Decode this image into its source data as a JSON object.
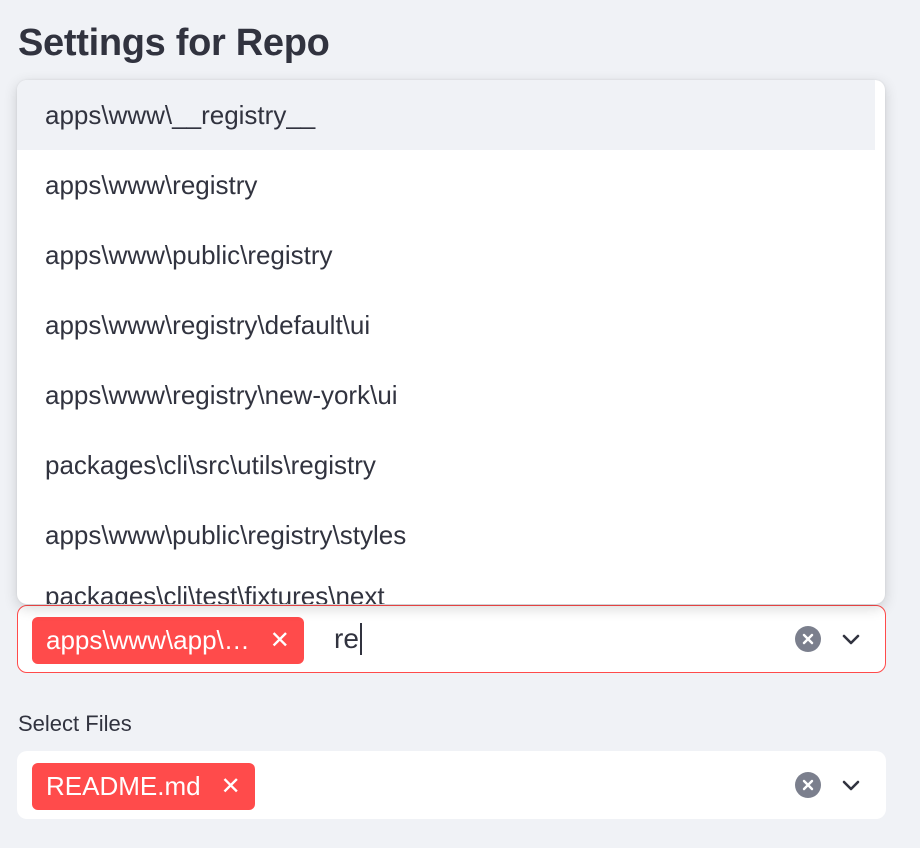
{
  "page": {
    "title": "Settings for Repo"
  },
  "dropdown": {
    "options": [
      "apps\\www\\__registry__",
      "apps\\www\\registry",
      "apps\\www\\public\\registry",
      "apps\\www\\registry\\default\\ui",
      "apps\\www\\registry\\new-york\\ui",
      "packages\\cli\\src\\utils\\registry",
      "apps\\www\\public\\registry\\styles",
      "packages\\cli\\test\\fixtures\\next"
    ],
    "highlighted_index": 0
  },
  "folders_select": {
    "selected_tag": "apps\\www\\app\\…",
    "remove_glyph": "✕",
    "typed_text": "re"
  },
  "files_select": {
    "label": "Select Files",
    "selected_tag": "README.md",
    "remove_glyph": "✕"
  },
  "icons": {
    "clear": "clear-circle-icon",
    "dropdown": "chevron-down-icon",
    "remove": "close-icon"
  },
  "colors": {
    "accent": "#ff4b4b",
    "background": "#f0f2f6",
    "text": "#31333f",
    "icon_gray": "#7b7f8d",
    "surface": "#ffffff"
  }
}
